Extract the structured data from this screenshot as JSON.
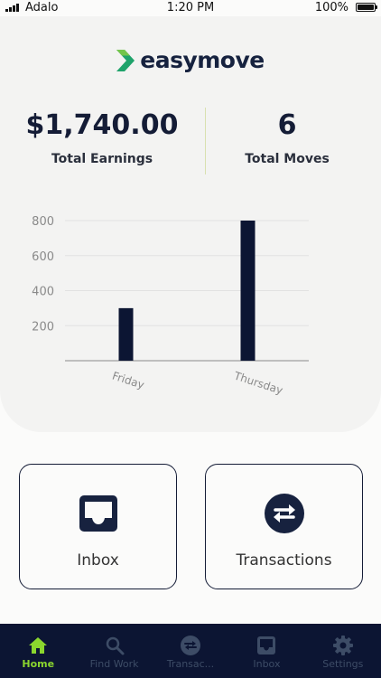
{
  "status_bar": {
    "carrier": "Adalo",
    "time": "1:20 PM",
    "battery": "100%"
  },
  "brand": {
    "name": "easymove",
    "colors": {
      "primary": "#16223f",
      "accent": "#1fa36b"
    }
  },
  "stats": {
    "earnings": {
      "value": "$1,740.00",
      "label": "Total Earnings"
    },
    "moves": {
      "value": "6",
      "label": "Total Moves"
    }
  },
  "chart_data": {
    "type": "bar",
    "categories": [
      "Friday",
      "Thursday"
    ],
    "values": [
      300,
      800
    ],
    "ylim": [
      0,
      800
    ],
    "yticks": [
      200,
      400,
      600,
      800
    ],
    "grid": true,
    "bar_color": "#0c1533"
  },
  "cards": {
    "inbox": {
      "label": "Inbox",
      "icon": "inbox-icon"
    },
    "transactions": {
      "label": "Transactions",
      "icon": "swap-arrows-icon"
    }
  },
  "tabs": [
    {
      "label": "Home",
      "icon": "home-icon",
      "active": true
    },
    {
      "label": "Find Work",
      "icon": "search-icon",
      "active": false
    },
    {
      "label": "Transac...",
      "icon": "swap-arrows-icon",
      "active": false
    },
    {
      "label": "Inbox",
      "icon": "inbox-icon",
      "active": false
    },
    {
      "label": "Settings",
      "icon": "gear-icon",
      "active": false
    }
  ]
}
